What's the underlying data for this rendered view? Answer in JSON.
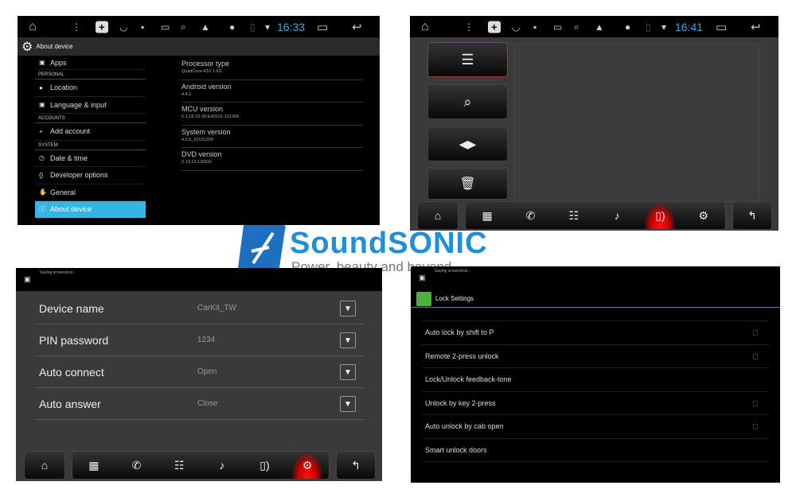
{
  "colors": {
    "accent": "#33b5e5",
    "clock": "#3aa7e0",
    "brand": "#1e8fd8",
    "active_nav": "#ff1a1a",
    "lock_icon": "#4caf3e"
  },
  "panel1": {
    "clock": "16:33",
    "title": "About device",
    "sidebar": [
      {
        "type": "item",
        "label": "Apps",
        "icon": "apps-icon"
      },
      {
        "type": "header",
        "label": "PERSONAL"
      },
      {
        "type": "item",
        "label": "Location",
        "icon": "location-icon"
      },
      {
        "type": "item",
        "label": "Language & input",
        "icon": "keyboard-icon"
      },
      {
        "type": "header",
        "label": "ACCOUNTS"
      },
      {
        "type": "item",
        "label": "Add account",
        "icon": "plus-icon"
      },
      {
        "type": "header",
        "label": "SYSTEM"
      },
      {
        "type": "item",
        "label": "Date & time",
        "icon": "clock-icon"
      },
      {
        "type": "item",
        "label": "Developer options",
        "icon": "braces-icon"
      },
      {
        "type": "item",
        "label": "General",
        "icon": "hand-icon"
      },
      {
        "type": "item",
        "label": "About device",
        "icon": "info-icon",
        "selected": true
      }
    ],
    "details": [
      {
        "label": "Processor type",
        "value": "QuadCore-R16 1.6G"
      },
      {
        "label": "Android version",
        "value": "4.4.2"
      },
      {
        "label": "MCU version",
        "value": "5.3.18-23-30-E43101-151209"
      },
      {
        "label": "System version",
        "value": "4.5.5_20151209"
      },
      {
        "label": "DVD version",
        "value": "2.13.13-1200xh"
      }
    ]
  },
  "panel2": {
    "clock": "16:41",
    "side_buttons": [
      "list-icon",
      "search-icon",
      "connect-icon",
      "trash-icon"
    ],
    "active_nav": "phone-link"
  },
  "logo": {
    "brand": "SoundSONIC",
    "tagline": "Power, beauty and beyond"
  },
  "panel3": {
    "notification": "Saving screenshot...",
    "settings": [
      {
        "label": "Device name",
        "value": "CarKit_TW"
      },
      {
        "label": "PIN password",
        "value": "1234"
      },
      {
        "label": "Auto connect",
        "value": "Open"
      },
      {
        "label": "Auto answer",
        "value": "Close"
      }
    ],
    "active_nav": "settings"
  },
  "panel4": {
    "notification": "Saving screenshot...",
    "title": "Lock Settings",
    "items": [
      {
        "label": "Auto lock by shift to P",
        "checked": false,
        "checkbox": true
      },
      {
        "label": "Remote 2-press unlock",
        "checked": false,
        "checkbox": true
      },
      {
        "label": "Lock/Unlock feedback-tone",
        "checkbox": false
      },
      {
        "label": "Unlock by key 2-press",
        "checked": false,
        "checkbox": true
      },
      {
        "label": "Auto unlock by cab open",
        "checked": false,
        "checkbox": true
      },
      {
        "label": "Smart unlock doors",
        "checkbox": false
      }
    ]
  },
  "nav": {
    "home": "⌂",
    "items": [
      {
        "id": "keypad",
        "glyph": "▦"
      },
      {
        "id": "call-log",
        "glyph": "✆"
      },
      {
        "id": "contacts",
        "glyph": "☷"
      },
      {
        "id": "music",
        "glyph": "♪"
      },
      {
        "id": "phone-link",
        "glyph": "▯)"
      },
      {
        "id": "settings",
        "glyph": "⚙"
      }
    ],
    "back": "↰"
  }
}
